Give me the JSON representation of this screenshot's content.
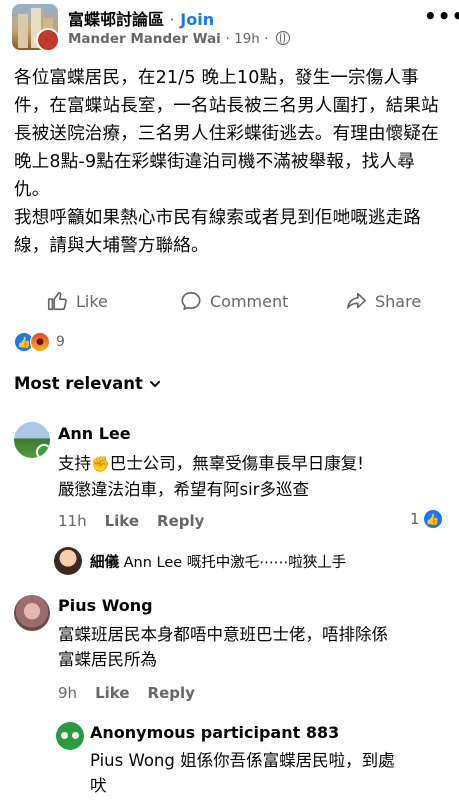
{
  "header": {
    "group_name": "富蝶邨討論區",
    "separator": "·",
    "join_label": "Join",
    "author": "Mander Mander Wai",
    "time": "19h",
    "more_label": "•••"
  },
  "post": {
    "paragraph1": "各位富蝶居民，在21/5 晚上10點，發生一宗傷人事件，在富蝶站長室，一名站長被三名男人圍打，結果站長被送院治療，三名男人住彩蝶街逃去。有理由懷疑在晚上8點-9點在彩蝶街違泊司機不滿被舉報，找人尋仇。",
    "paragraph2": "我想呼籲如果熱心市民有線索或者見到佢哋嘅逃走路線，請與大埔警方聯絡。"
  },
  "actions": {
    "like": "Like",
    "comment": "Comment",
    "share": "Share"
  },
  "reactions": {
    "count": "9"
  },
  "sort_label": "Most relevant",
  "comments": [
    {
      "name": "Ann Lee",
      "text_line1_a": "支持",
      "text_line1_b": "巴士公司，無辜受傷車長早日康复!",
      "text_line2": "嚴懲違法泊車，希望有阿sir多巡查",
      "time": "11h",
      "like": "Like",
      "reply": "Reply",
      "like_count": "1",
      "reply_preview": {
        "name": "細儀",
        "mention": "Ann Lee",
        "text": "嘅托中激乇⋯⋯啦狹丄手"
      }
    },
    {
      "name": "Pius Wong",
      "text_line1": "富蝶班居民本身都唔中意班巴士佬，唔排除係",
      "text_line2": "富蝶居民所為",
      "time": "9h",
      "like": "Like",
      "reply": "Reply"
    },
    {
      "name": "Anonymous participant 883",
      "text_line1": "Pius Wong 姐係你吾係富蝶居民啦，到處",
      "text_line2": "吠"
    }
  ],
  "colors": {
    "accent": "#1877f2",
    "secondary_text": "#65676b"
  }
}
